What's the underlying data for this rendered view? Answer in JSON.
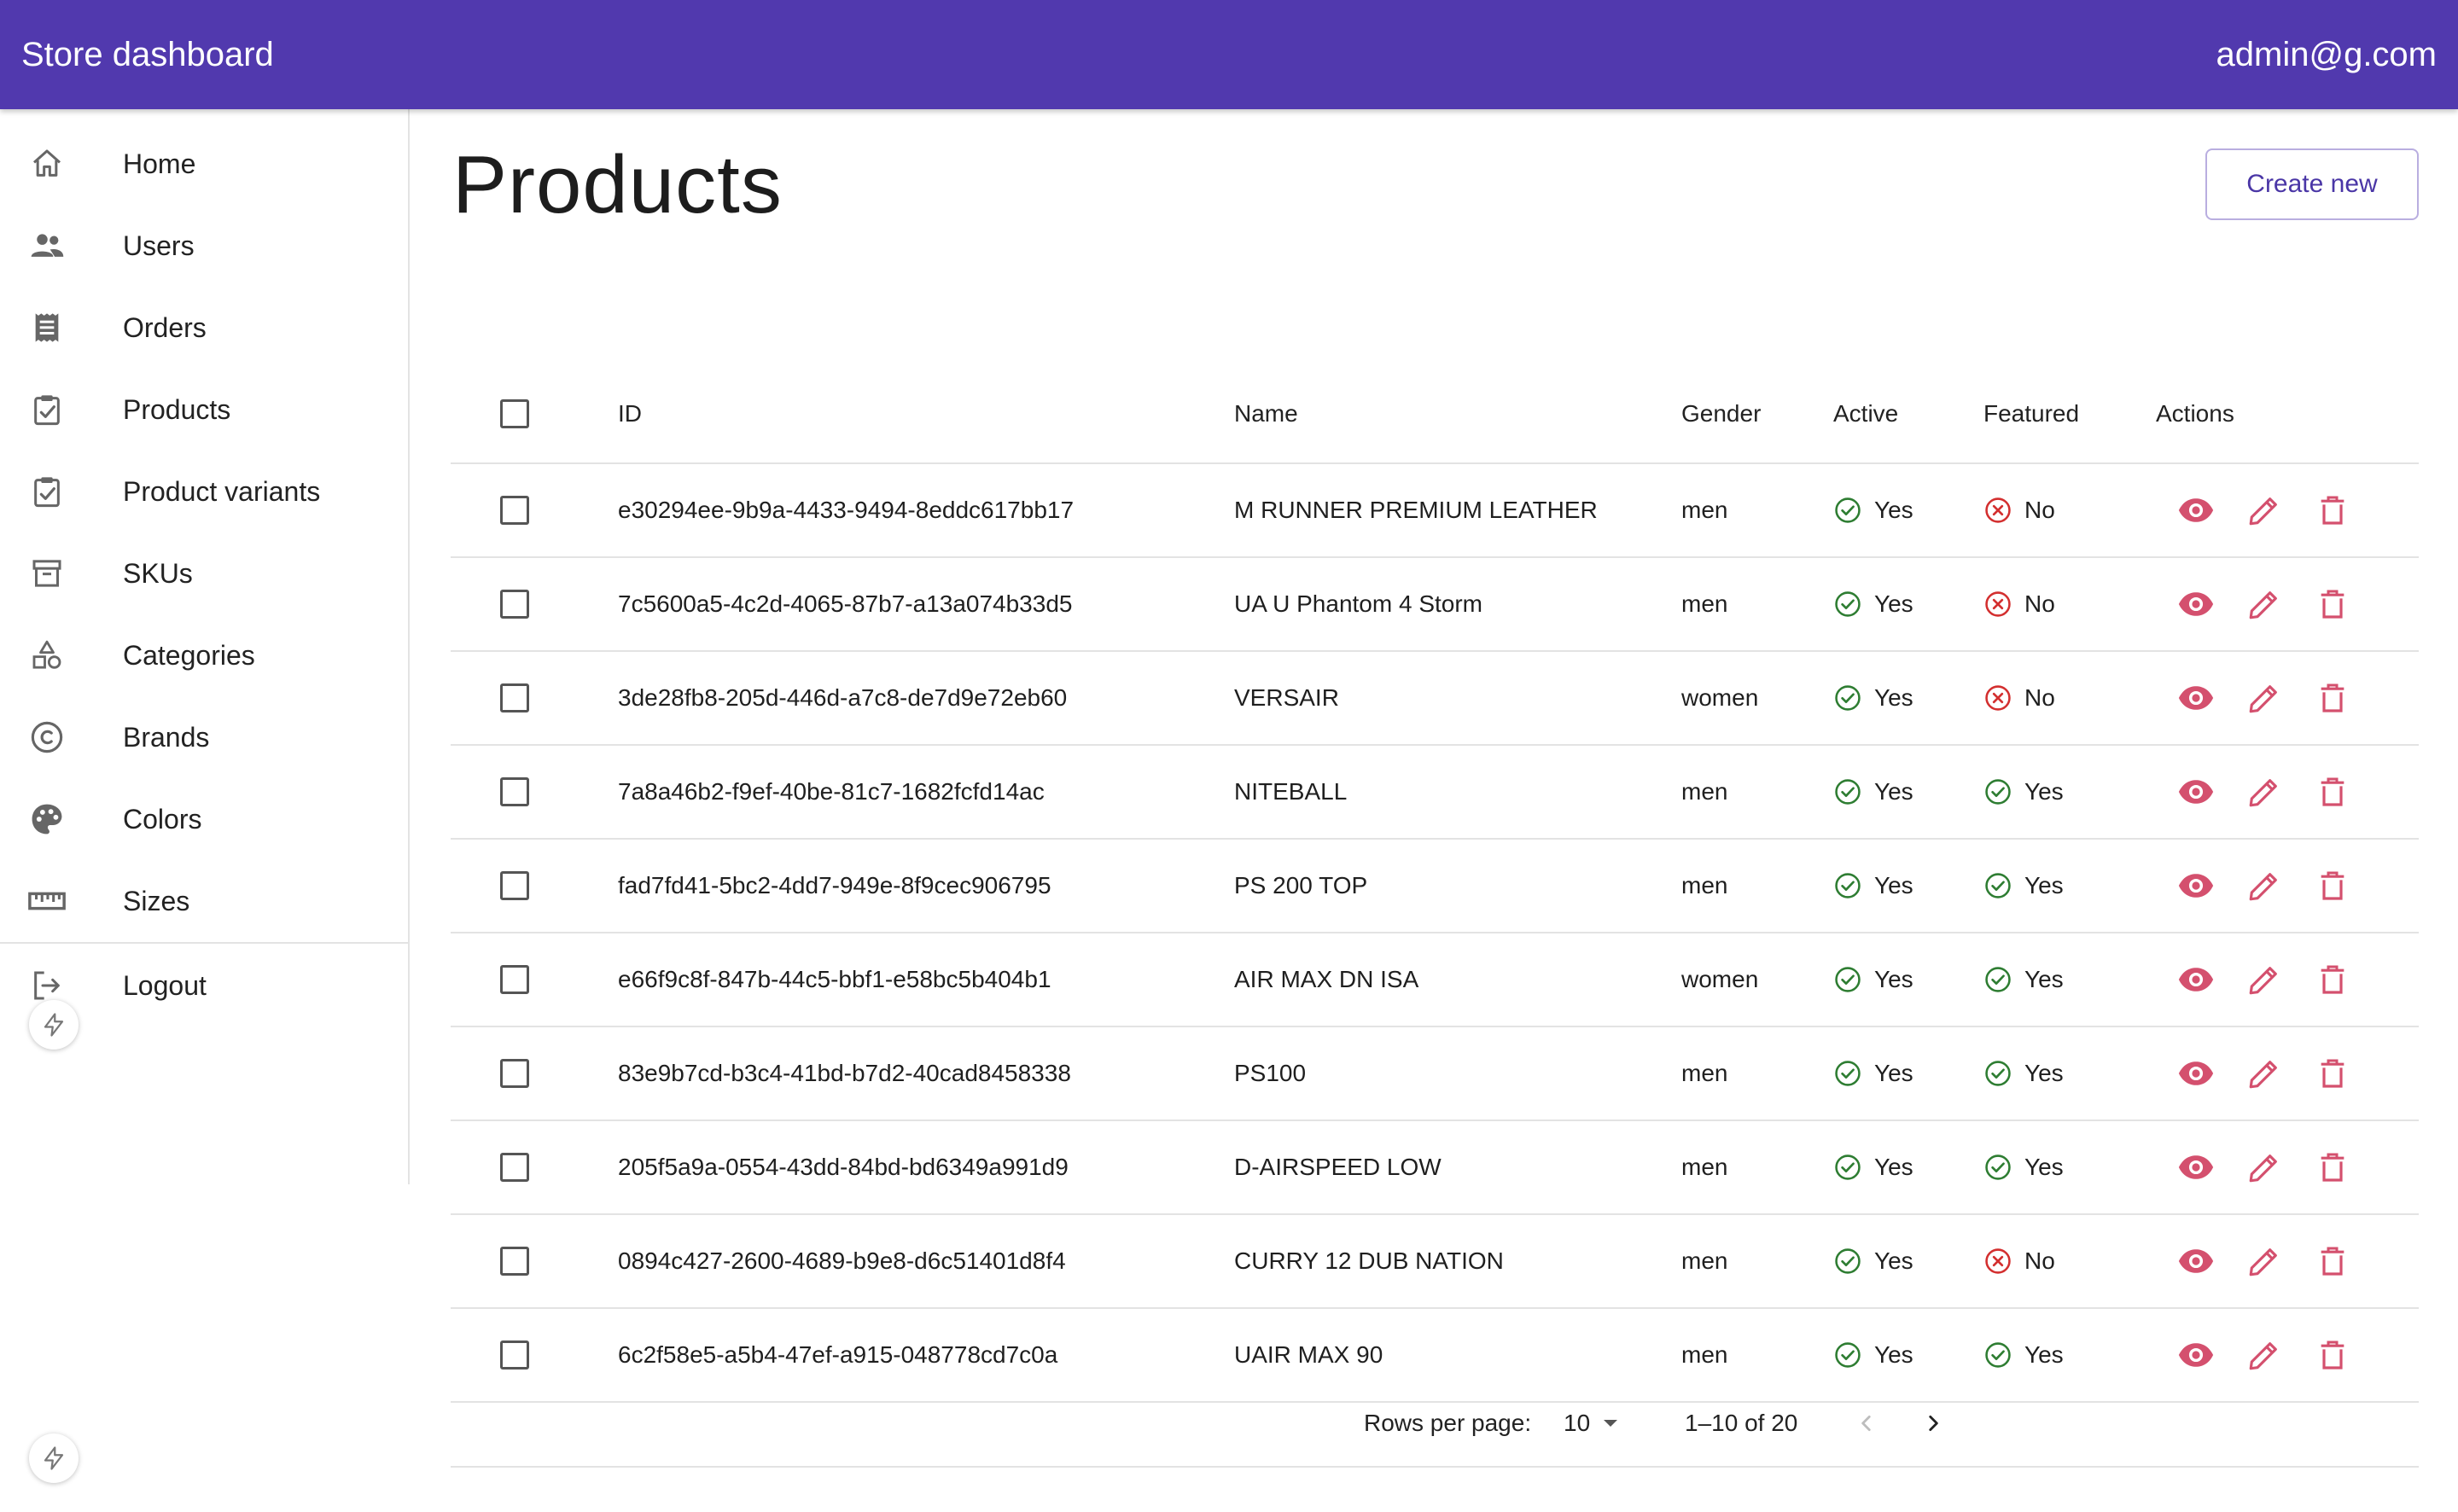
{
  "header": {
    "title": "Store dashboard",
    "user_email": "admin@g.com",
    "bar_color": "#5139ae"
  },
  "sidebar": {
    "items": [
      {
        "label": "Home",
        "icon": "home-icon"
      },
      {
        "label": "Users",
        "icon": "users-icon"
      },
      {
        "label": "Orders",
        "icon": "receipt-icon"
      },
      {
        "label": "Products",
        "icon": "clipboard-check-icon"
      },
      {
        "label": "Product variants",
        "icon": "clipboard-check-icon"
      },
      {
        "label": "SKUs",
        "icon": "archive-box-icon"
      },
      {
        "label": "Categories",
        "icon": "shapes-icon"
      },
      {
        "label": "Brands",
        "icon": "copyright-icon"
      },
      {
        "label": "Colors",
        "icon": "palette-icon"
      },
      {
        "label": "Sizes",
        "icon": "ruler-icon"
      }
    ],
    "logout": {
      "label": "Logout",
      "icon": "logout-icon"
    }
  },
  "page": {
    "title": "Products",
    "create_label": "Create new"
  },
  "table": {
    "columns": [
      "ID",
      "Name",
      "Gender",
      "Active",
      "Featured",
      "Actions"
    ],
    "rows": [
      {
        "id": "e30294ee-9b9a-4433-9494-8eddc617bb17",
        "name": "M RUNNER PREMIUM LEATHER",
        "gender": "men",
        "active": "Yes",
        "featured": "No"
      },
      {
        "id": "7c5600a5-4c2d-4065-87b7-a13a074b33d5",
        "name": "UA U Phantom 4 Storm",
        "gender": "men",
        "active": "Yes",
        "featured": "No"
      },
      {
        "id": "3de28fb8-205d-446d-a7c8-de7d9e72eb60",
        "name": "VERSAIR",
        "gender": "women",
        "active": "Yes",
        "featured": "No"
      },
      {
        "id": "7a8a46b2-f9ef-40be-81c7-1682fcfd14ac",
        "name": "NITEBALL",
        "gender": "men",
        "active": "Yes",
        "featured": "Yes"
      },
      {
        "id": "fad7fd41-5bc2-4dd7-949e-8f9cec906795",
        "name": "PS 200 TOP",
        "gender": "men",
        "active": "Yes",
        "featured": "Yes"
      },
      {
        "id": "e66f9c8f-847b-44c5-bbf1-e58bc5b404b1",
        "name": "AIR MAX DN ISA",
        "gender": "women",
        "active": "Yes",
        "featured": "Yes"
      },
      {
        "id": "83e9b7cd-b3c4-41bd-b7d2-40cad8458338",
        "name": "PS100",
        "gender": "men",
        "active": "Yes",
        "featured": "Yes"
      },
      {
        "id": "205f5a9a-0554-43dd-84bd-bd6349a991d9",
        "name": "D-AIRSPEED LOW",
        "gender": "men",
        "active": "Yes",
        "featured": "Yes"
      },
      {
        "id": "0894c427-2600-4689-b9e8-d6c51401d8f4",
        "name": "CURRY 12 DUB NATION",
        "gender": "men",
        "active": "Yes",
        "featured": "No"
      },
      {
        "id": "6c2f58e5-a5b4-47ef-a915-048778cd7c0a",
        "name": "UAIR MAX 90",
        "gender": "men",
        "active": "Yes",
        "featured": "Yes"
      }
    ]
  },
  "pagination": {
    "rows_per_page_label": "Rows per page:",
    "rows_per_page": "10",
    "range": "1–10 of 20"
  },
  "colors": {
    "yes": "#2e7d32",
    "no": "#d32f2f",
    "action": "#d4506e",
    "accent": "#4a36a6"
  }
}
